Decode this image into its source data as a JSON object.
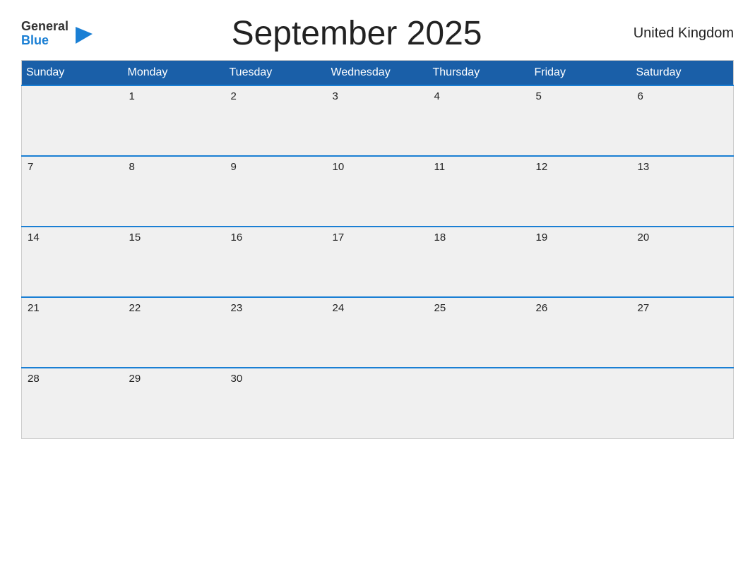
{
  "header": {
    "logo_general": "General",
    "logo_blue": "Blue",
    "title": "September 2025",
    "country": "United Kingdom"
  },
  "calendar": {
    "days_of_week": [
      "Sunday",
      "Monday",
      "Tuesday",
      "Wednesday",
      "Thursday",
      "Friday",
      "Saturday"
    ],
    "weeks": [
      [
        "",
        "1",
        "2",
        "3",
        "4",
        "5",
        "6"
      ],
      [
        "7",
        "8",
        "9",
        "10",
        "11",
        "12",
        "13"
      ],
      [
        "14",
        "15",
        "16",
        "17",
        "18",
        "19",
        "20"
      ],
      [
        "21",
        "22",
        "23",
        "24",
        "25",
        "26",
        "27"
      ],
      [
        "28",
        "29",
        "30",
        "",
        "",
        "",
        ""
      ]
    ]
  }
}
